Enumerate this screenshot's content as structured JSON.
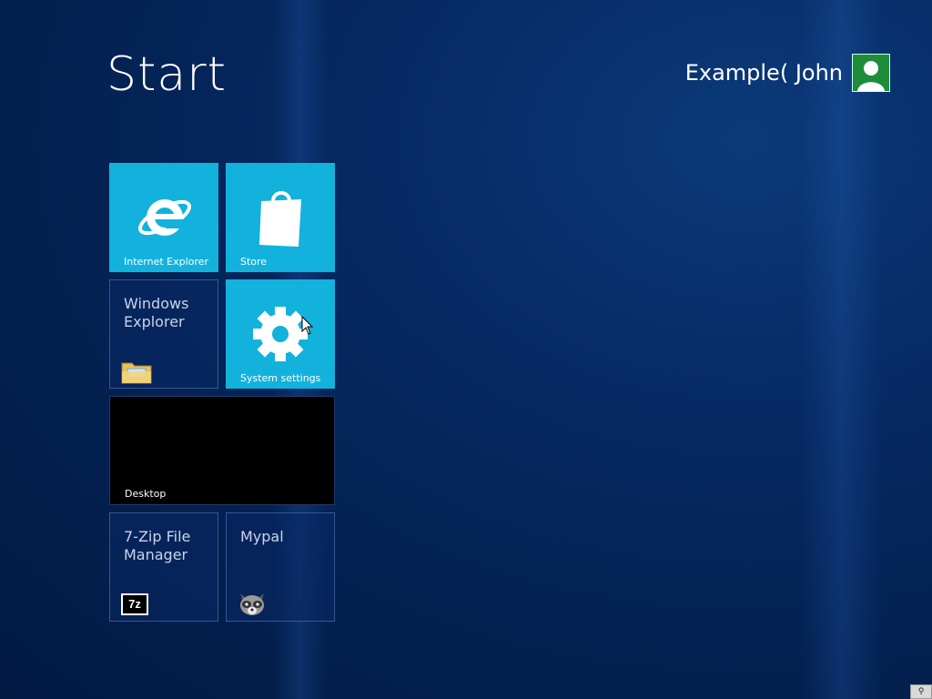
{
  "header": {
    "title": "Start",
    "user_name": "Example( John"
  },
  "tiles": [
    {
      "id": "internet-explorer",
      "label": "Internet Explorer",
      "color": "#12b2dd",
      "icon": "internet-explorer-icon"
    },
    {
      "id": "store",
      "label": "Store",
      "color": "#12b2dd",
      "icon": "shopping-bag-icon"
    },
    {
      "id": "windows-explorer",
      "label": "Windows Explorer",
      "icon": "folder-icon"
    },
    {
      "id": "system-settings",
      "label": "System settings",
      "color": "#12b2dd",
      "icon": "gear-icon"
    },
    {
      "id": "desktop",
      "label": "Desktop",
      "color": "#000000"
    },
    {
      "id": "7zip",
      "label": "7-Zip File Manager",
      "icon": "7z-icon",
      "icon_text": "7z"
    },
    {
      "id": "mypal",
      "label": "Mypal",
      "icon": "raccoon-icon"
    }
  ],
  "colors": {
    "background": "#03204f",
    "tile_accent": "#12b2dd",
    "avatar": "#1f8c3c"
  }
}
